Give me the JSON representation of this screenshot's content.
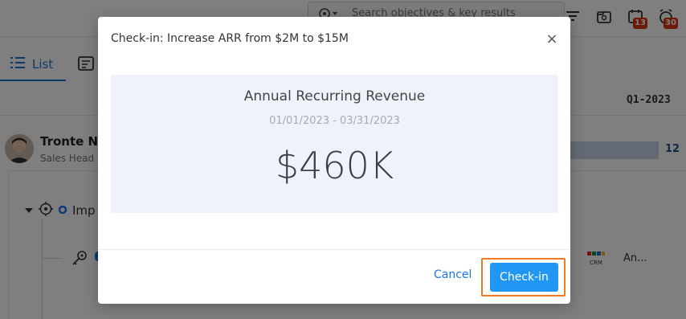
{
  "topbar": {
    "search_placeholder": "Search objectives & key results",
    "badge_one": "13",
    "badge_two": "30"
  },
  "view_tabs": {
    "list_label": "List"
  },
  "period": {
    "quarter": "Q1-2023"
  },
  "owner": {
    "name": "Tronte Ni",
    "role": "Sales Head",
    "progress_text": "12"
  },
  "tree": {
    "objective_label": "Imp",
    "kr_paren": ")",
    "kr_more": "An..."
  },
  "modal": {
    "title": "Check-in: Increase ARR from $2M to $15M",
    "close_symbol": "×",
    "metric_name": "Annual Recurring Revenue",
    "metric_dates": "01/01/2023 - 03/31/2023",
    "metric_value": "$460K",
    "cancel_label": "Cancel",
    "checkin_label": "Check-in"
  },
  "icons": {
    "search": "target-icon",
    "filter": "filter-icon",
    "export": "export-icon",
    "calendar": "calendar-icon",
    "alarm": "alarm-icon"
  },
  "colors": {
    "accent": "#2196f3",
    "highlight": "#ef7a22",
    "badge": "#d9320e"
  }
}
